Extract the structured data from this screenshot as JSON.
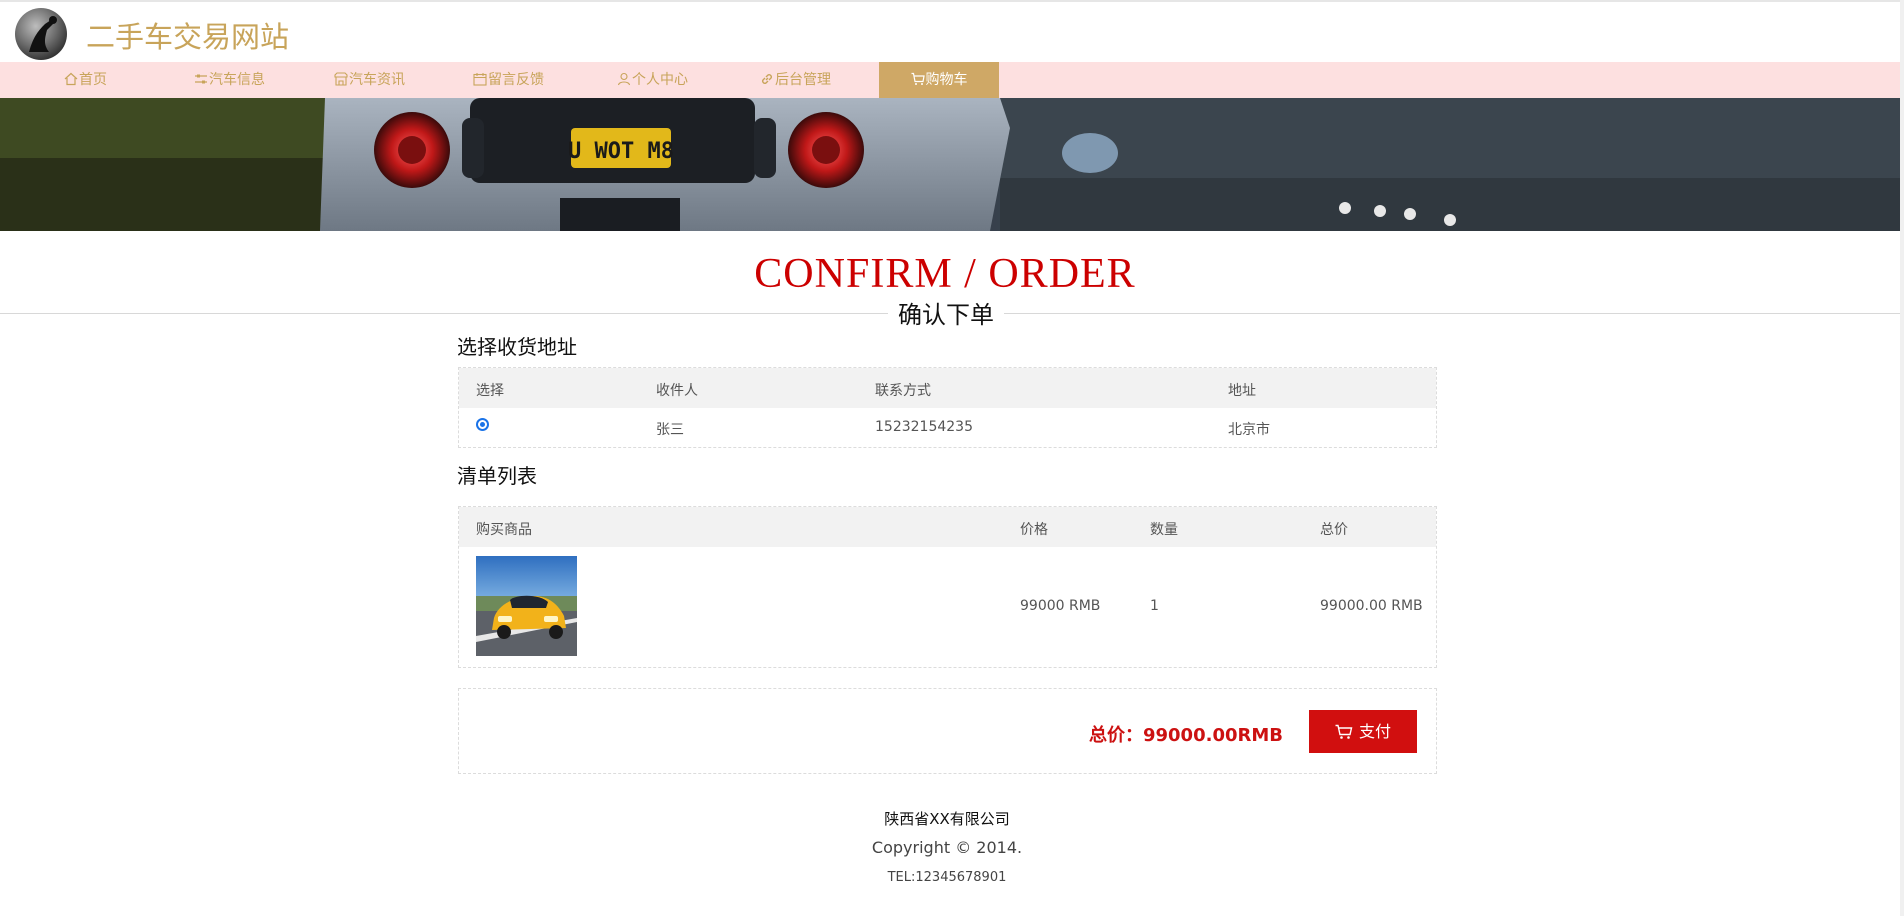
{
  "header": {
    "site_title": "二手车交易网站"
  },
  "nav": {
    "items": [
      {
        "label": "首页",
        "icon": "home-icon"
      },
      {
        "label": "汽车信息",
        "icon": "sliders-icon"
      },
      {
        "label": "汽车资讯",
        "icon": "shop-icon"
      },
      {
        "label": "留言反馈",
        "icon": "calendar-icon"
      },
      {
        "label": "个人中心",
        "icon": "user-icon"
      },
      {
        "label": "后台管理",
        "icon": "link-icon"
      },
      {
        "label": "购物车",
        "icon": "cart-icon",
        "active": true
      }
    ]
  },
  "banner": {
    "plate_text": "U WOT M8"
  },
  "page": {
    "title": "CONFIRM / ORDER",
    "subtitle": "确认下单"
  },
  "address": {
    "section_title": "选择收货地址",
    "columns": [
      "选择",
      "收件人",
      "联系方式",
      "地址"
    ],
    "rows": [
      {
        "selected": true,
        "recipient": "张三",
        "phone": "15232154235",
        "address": "北京市"
      }
    ]
  },
  "order": {
    "section_title": "清单列表",
    "columns": [
      "购买商品",
      "价格",
      "数量",
      "总价"
    ],
    "rows": [
      {
        "price": "99000 RMB",
        "quantity": "1",
        "subtotal": "99000.00 RMB"
      }
    ]
  },
  "summary": {
    "total_text": "总价：99000.00RMB",
    "pay_label": "支付"
  },
  "footer": {
    "company": "陕西省XX有限公司",
    "copyright": "Copyright © 2014.",
    "tel": "TEL:12345678901"
  },
  "colors": {
    "brand": "#c8a45a",
    "nav_bg": "#fde0e0",
    "nav_active": "#cfa866",
    "accent_red": "#cc0000",
    "pay_button": "#d10f0f"
  }
}
